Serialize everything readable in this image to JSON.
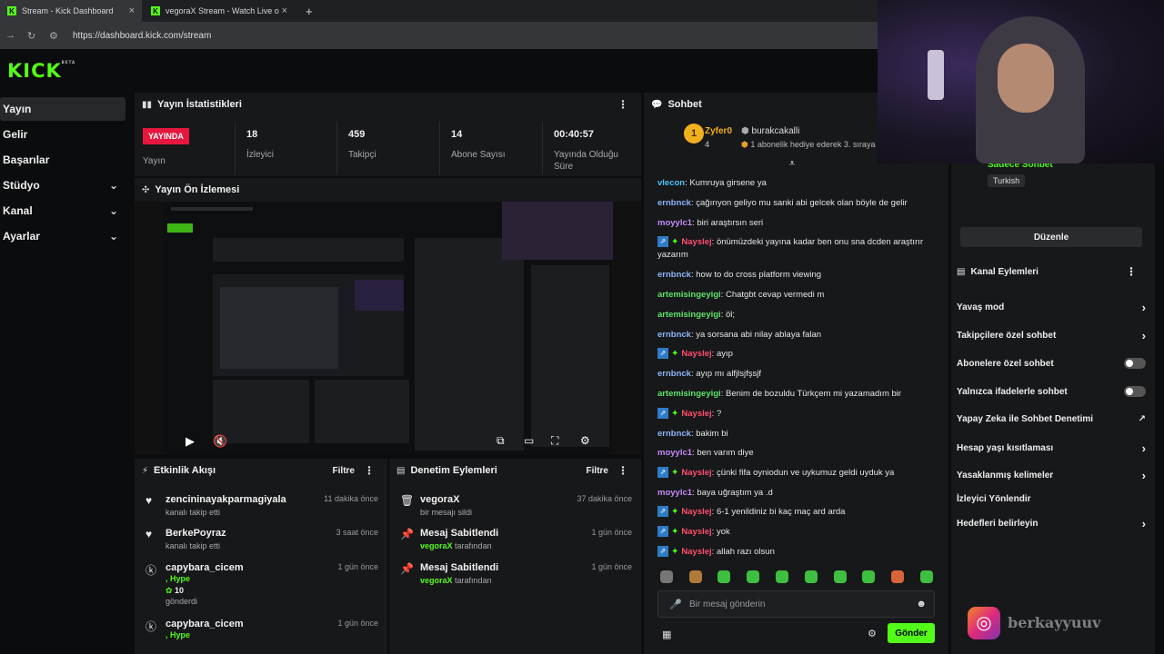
{
  "browser": {
    "tabs": [
      {
        "title": "Stream - Kick Dashboard"
      },
      {
        "title": "vegoraX Stream - Watch Live o"
      }
    ],
    "url": "https://dashboard.kick.com/stream"
  },
  "brand": {
    "logo": "KICK",
    "logo_sup": "BETA",
    "accent": "#53fc18"
  },
  "sidebar": {
    "items": [
      {
        "label": "Yayın"
      },
      {
        "label": "Gelir"
      },
      {
        "label": "Başarılar"
      },
      {
        "label": "Stüdyo"
      },
      {
        "label": "Kanal"
      },
      {
        "label": "Ayarlar"
      }
    ]
  },
  "stats": {
    "title": "Yayın İstatistikleri",
    "live_badge": "YAYINDA",
    "live_label": "Yayın",
    "items": [
      {
        "value": "18",
        "label": "İzleyici"
      },
      {
        "value": "459",
        "label": "Takipçi"
      },
      {
        "value": "14",
        "label": "Abone Sayısı"
      },
      {
        "value": "00:40:57",
        "label": "Yayında Olduğu Süre"
      }
    ]
  },
  "preview": {
    "title": "Yayın Ön İzlemesi"
  },
  "activity": {
    "title": "Etkinlik Akışı",
    "filter": "Filtre",
    "events": [
      {
        "name": "zencininayakparmagiyala",
        "sub": "kanalı takip etti",
        "time": "11 dakika önce"
      },
      {
        "name": "BerkePoyraz",
        "sub": "kanalı takip etti",
        "time": "3 saat önce"
      },
      {
        "name": "capybara_cicem",
        "sub": ", Hype",
        "extra": "10",
        "extra2": "gönderdi",
        "time": "1 gün önce"
      },
      {
        "name": "capybara_cicem",
        "sub": ", Hype",
        "time": "1 gün önce"
      }
    ]
  },
  "moderation": {
    "title": "Denetim Eylemleri",
    "filter": "Filtre",
    "events": [
      {
        "name": "vegoraX",
        "sub": "bir mesajı sildi",
        "time": "37 dakika önce"
      },
      {
        "name": "Mesaj Sabitlendi",
        "sub_user": "vegoraX",
        "sub": "tarafından",
        "time": "1 gün önce"
      },
      {
        "name": "Mesaj Sabitlendi",
        "sub_user": "vegoraX",
        "sub": "tarafından",
        "time": "1 gün önce"
      }
    ]
  },
  "chat": {
    "title": "Sohbet",
    "gifter": {
      "name": "Zyfer0",
      "count": "4",
      "to": "burakcakalli",
      "text": "1 abonelik hediye ederek 3. sıraya"
    },
    "messages": [
      {
        "user": "vlecon",
        "color": "#4fc3f7",
        "text": "Kumruya girsene ya"
      },
      {
        "user": "ernbnck",
        "color": "#8ab4f8",
        "text": "çağırıyon geliyo mu sanki abi gelcek olan böyle de gelir"
      },
      {
        "user": "moyylc1",
        "color": "#c58af9",
        "text": "biri araştırsın seri"
      },
      {
        "user": "Nayslej",
        "color": "#ff4d6d",
        "badges": true,
        "text": "önümüzdeki yayına kadar ben onu sna dcden araştırır yazarım"
      },
      {
        "user": "ernbnck",
        "color": "#8ab4f8",
        "text": "how to do cross platform viewing"
      },
      {
        "user": "artemisingeyigi",
        "color": "#5de36b",
        "text": "Chatgbt cevap vermedi m"
      },
      {
        "user": "artemisingeyigi",
        "color": "#5de36b",
        "text": "öl;"
      },
      {
        "user": "ernbnck",
        "color": "#8ab4f8",
        "text": "ya sorsana abi nilay ablaya falan"
      },
      {
        "user": "Nayslej",
        "color": "#ff4d6d",
        "badges": true,
        "text": "ayıp"
      },
      {
        "user": "ernbnck",
        "color": "#8ab4f8",
        "text": "ayıp mı alfjlsjfşsjf"
      },
      {
        "user": "artemisingeyigi",
        "color": "#5de36b",
        "text": "Benim de bozuldu Türkçem mi yazamadım bir"
      },
      {
        "user": "Nayslej",
        "color": "#ff4d6d",
        "badges": true,
        "text": "?"
      },
      {
        "user": "ernbnck",
        "color": "#8ab4f8",
        "text": "bakim bi"
      },
      {
        "user": "moyylc1",
        "color": "#c58af9",
        "text": "ben varım diye"
      },
      {
        "user": "Nayslej",
        "color": "#ff4d6d",
        "badges": true,
        "text": "çünki fifa oyniodun ve uykumuz geldi uyduk ya"
      },
      {
        "user": "moyylc1",
        "color": "#c58af9",
        "text": "baya uğraştım ya .d"
      },
      {
        "user": "Nayslej",
        "color": "#ff4d6d",
        "badges": true,
        "text": "6-1 yenildiniz bi kaç maç ard arda"
      },
      {
        "user": "Nayslej",
        "color": "#ff4d6d",
        "badges": true,
        "text": "yok"
      },
      {
        "user": "Nayslej",
        "color": "#ff4d6d",
        "badges": true,
        "text": "allah razı olsun"
      }
    ],
    "input_placeholder": "Bir mesaj gönderin",
    "send_label": "Gönder"
  },
  "channel": {
    "mode_label": "Sadece Sohbet",
    "language": "Turkish",
    "edit_label": "Düzenle",
    "actions_title": "Kanal Eylemleri",
    "actions": [
      {
        "label": "Yavaş mod",
        "kind": "arrow"
      },
      {
        "label": "Takipçilere özel sohbet",
        "kind": "arrow"
      },
      {
        "label": "Abonelere özel sohbet",
        "kind": "toggle"
      },
      {
        "label": "Yalnızca ifadelerle sohbet",
        "kind": "toggle"
      },
      {
        "label": "Yapay Zeka ile Sohbet Denetimi",
        "kind": "external"
      },
      {
        "label": "Hesap yaşı kısıtlaması",
        "kind": "arrow"
      },
      {
        "label": "Yasaklanmış kelimeler",
        "kind": "arrow"
      },
      {
        "label": "İzleyici Yönlendir",
        "kind": "none"
      },
      {
        "label": "Hedefleri belirleyin",
        "kind": "arrow"
      }
    ]
  },
  "overlay": {
    "watermark": "berkayyuuv",
    "brand_overlay": "vegoraX"
  }
}
